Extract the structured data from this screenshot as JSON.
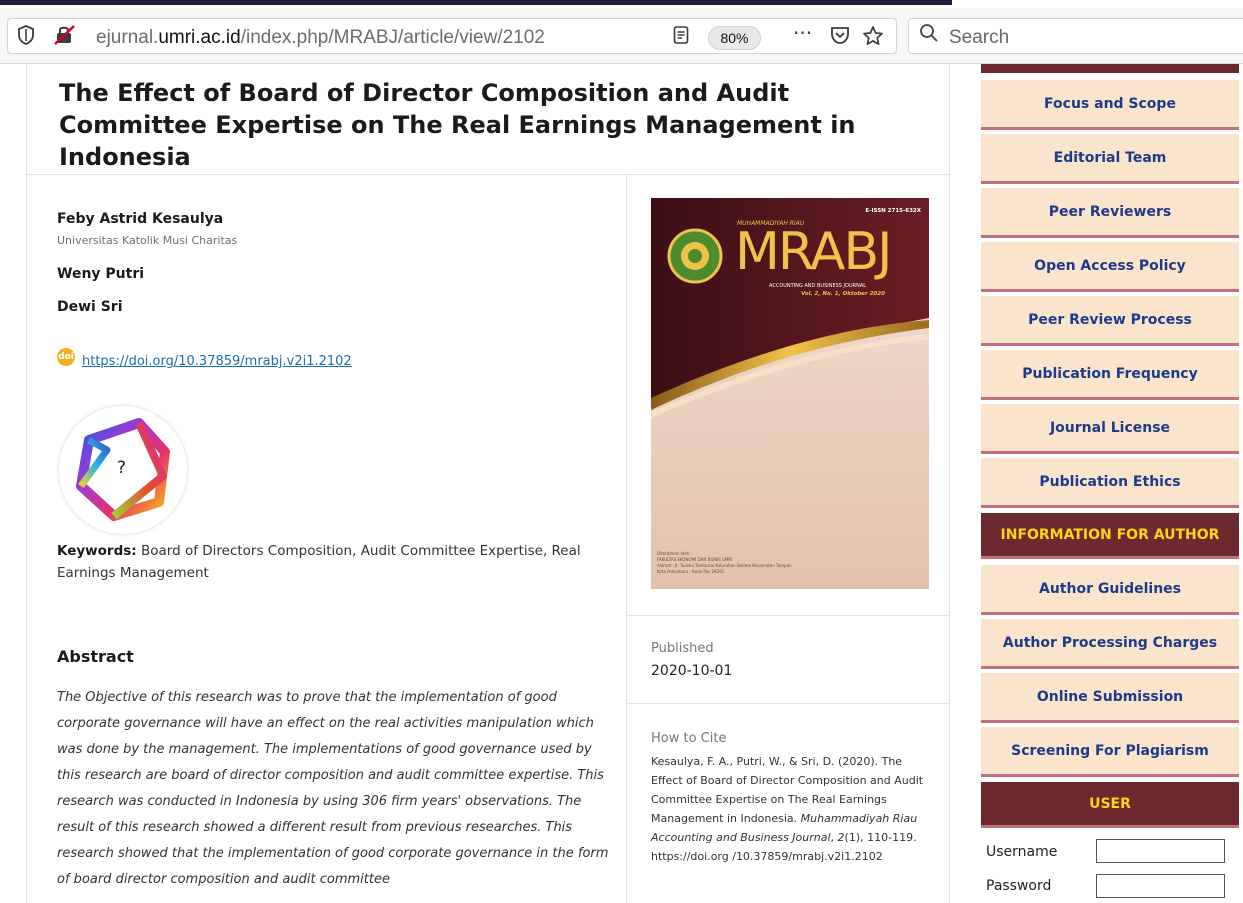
{
  "browser": {
    "url_prefix": "ejurnal.",
    "url_domain": "umri.ac.id",
    "url_path": "/index.php/MRABJ/article/view/2102",
    "zoom": "80%",
    "search_placeholder": "Search"
  },
  "article": {
    "title": "The Effect of Board of Director Composition and Audit Committee Expertise on The Real Earnings Management in Indonesia",
    "authors": [
      {
        "name": "Feby Astrid Kesaulya",
        "affiliation": "Universitas Katolik Musi Charitas"
      },
      {
        "name": "Weny Putri"
      },
      {
        "name": "Dewi Sri"
      }
    ],
    "doi_icon_text": "doi",
    "doi": "https://doi.org/10.37859/mrabj.v2i1.2102",
    "badge_symbol": "?",
    "keywords_label": "Keywords:",
    "keywords": " Board of Directors Composition, Audit Committee Expertise, Real Earnings Management",
    "abstract_heading": "Abstract",
    "abstract": "The Objective of this research was to prove that the implementation of good corporate governance will have an effect on the real activities manipulation which was done by the management. The implementations of good governance used by this research are board of director composition and audit committee expertise. This research was conducted in Indonesia by using 306 firm years' observations. The result of this research showed a different result from previous researches. This research showed that the implementation of good corporate governance in the form of board director composition and audit committee"
  },
  "side": {
    "cover": {
      "issn": "E-ISSN 2715-632X",
      "journal_small": "MUHAMMADIYAH RIAU",
      "journal_big": "MRABJ",
      "journal_sub": "ACCOUNTING AND BUSINESS JOURNAL",
      "issue": "Vol. 2, No. 1, Oktober 2020",
      "footer_line1": "Diterbitkan oleh :",
      "footer_line2": "FAKULTAS EKONOMI DAN BISNIS UMRI",
      "footer_line3": "Alamat : Jl. Tuanku Tambusai Kelurahan Delima Kecamatan Tampan",
      "footer_line4": "Kota Pekanbaru - Kode Pos 28291"
    },
    "published_label": "Published",
    "published_date": "2020-10-01",
    "cite_label": "How to Cite",
    "cite_text_1": "Kesaulya, F. A., Putri, W., & Sri, D. (2020). The Effect of Board of Director Composition and Audit Committee Expertise on The Real Earnings Management in Indonesia. ",
    "cite_journal": "Muhammadiyah Riau Accounting and Business Journal",
    "cite_sep": ", ",
    "cite_volume": "2",
    "cite_text_2": "(1), 110-119. https://doi.org /10.37859/mrabj.v2i1.2102"
  },
  "sidebar": {
    "items_top": [
      "Focus and Scope",
      "Editorial Team",
      "Peer Reviewers",
      "Open Access Policy",
      "Peer Review Process",
      "Publication Frequency",
      "Journal License",
      "Publication Ethics"
    ],
    "info_heading": "INFORMATION FOR AUTHOR",
    "items_author": [
      "Author Guidelines",
      "Author Processing Charges",
      "Online Submission",
      "Screening For Plagiarism"
    ],
    "user_heading": "USER",
    "username_label": "Username",
    "password_label": "Password"
  },
  "colors": {
    "nav_bg": "#fbe4cc",
    "nav_text": "#1e3a8a",
    "nav_border": "#c0707a",
    "head_bg": "#6d2a2e",
    "head_text": "#ffd21c",
    "link": "#1b6db3"
  }
}
